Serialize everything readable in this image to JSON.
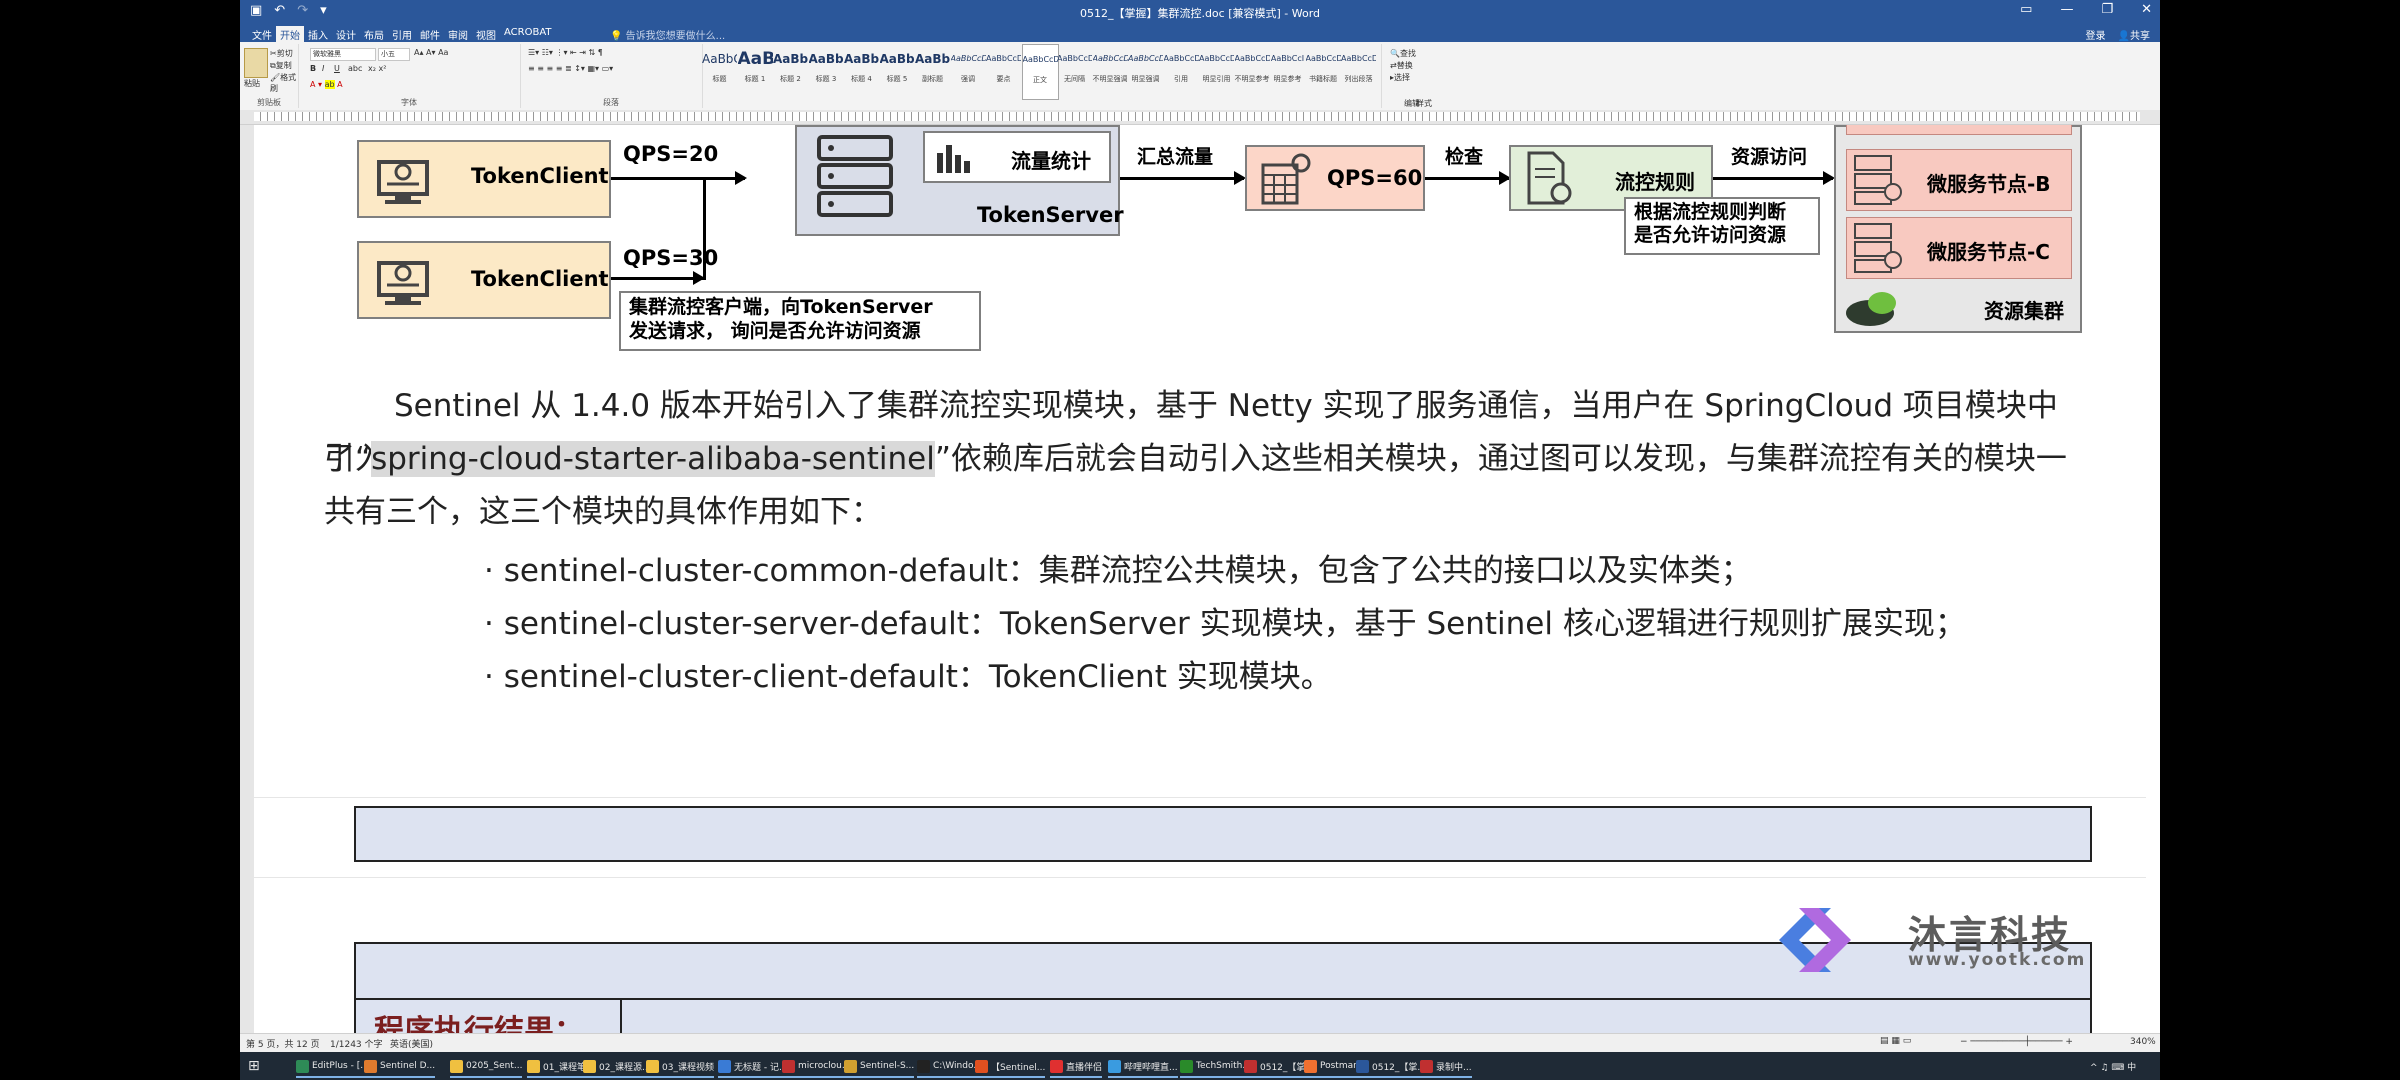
{
  "window": {
    "title": "0512_【掌握】集群流控.doc [兼容模式] - Word"
  },
  "menu": {
    "tabs": [
      "文件",
      "开始",
      "插入",
      "设计",
      "布局",
      "引用",
      "邮件",
      "审阅",
      "视图",
      "ACROBAT"
    ],
    "tell_me": "告诉我您想要做什么...",
    "sign_in": "登录",
    "share": "共享"
  },
  "ribbon": {
    "clipboard": {
      "paste": "粘贴",
      "cut": "剪切",
      "copy": "复制",
      "format_painter": "格式刷",
      "label": "剪贴板"
    },
    "font": {
      "name": "微软雅黑",
      "size": "小五",
      "label": "字体"
    },
    "paragraph": {
      "label": "段落"
    },
    "styles": {
      "label": "样式",
      "items": [
        {
          "preview": "AaBbC",
          "name": "标题"
        },
        {
          "preview": "AaBl",
          "name": "标题 1"
        },
        {
          "preview": "AaBbC",
          "name": "标题 2"
        },
        {
          "preview": "AaBbC",
          "name": "标题 3"
        },
        {
          "preview": "AaBbC",
          "name": "标题 4"
        },
        {
          "preview": "AaBbC",
          "name": "标题 5"
        },
        {
          "preview": "AaBbC",
          "name": "副标题"
        },
        {
          "preview": "AaBbCcDt",
          "name": "强调"
        },
        {
          "preview": "AaBbCcD",
          "name": "要点"
        },
        {
          "preview": "AaBbCcDc",
          "name": "正文"
        },
        {
          "preview": "AaBbCcDc",
          "name": "无间隔"
        },
        {
          "preview": "AaBbCcDc",
          "name": "不明显强调"
        },
        {
          "preview": "AaBbCcDc",
          "name": "明显强调"
        },
        {
          "preview": "AaBbCcDc",
          "name": "引用"
        },
        {
          "preview": "AaBbCcDc",
          "name": "明显引用"
        },
        {
          "preview": "AaBbCcD",
          "name": "不明显参考"
        },
        {
          "preview": "AaBbCcI",
          "name": "明显参考"
        },
        {
          "preview": "AaBbCcD",
          "name": "书籍标题"
        },
        {
          "preview": "AaBbCcDc",
          "name": "列出段落"
        }
      ]
    },
    "editing": {
      "find": "查找",
      "replace": "替换",
      "select": "选择",
      "label": "编辑"
    }
  },
  "diagram": {
    "client1": "TokenClient",
    "client2": "TokenClient",
    "qps1": "QPS=20",
    "qps2": "QPS=30",
    "client_note_1": "集群流控客户端，向TokenServer",
    "client_note_2": "发送请求， 询问是否允许访问资源",
    "flow_stat": "流量统计",
    "token_server": "TokenServer",
    "aggregate": "汇总流量",
    "qps_total": "QPS=60",
    "check": "检查",
    "flow_rule": "流控规则",
    "rule_note_1": "根据流控规则判断",
    "rule_note_2": "是否允许访问资源",
    "resource_access": "资源访问",
    "ms_b": "微服务节点-B",
    "ms_c": "微服务节点-C",
    "resource_cluster": "资源集群"
  },
  "body": {
    "para1_a": "Sentinel 从 1.4.0 版本开始引入了集群流控实现模块，基于 Netty 实现了服务通信，当用户在 SpringCloud 项目模块中引入",
    "para1_b_prefix": "了“",
    "para1_b_highlight": "spring-cloud-starter-alibaba-sentinel",
    "para1_b_suffix": "”依赖库后就会自动引入这些相关模块，通过图可以发现，与集群流控有关的模块一",
    "para1_c": "共有三个，这三个模块的具体作用如下：",
    "bullets": [
      "· sentinel-cluster-common-default：集群流控公共模块，包含了公共的接口以及实体类；",
      "· sentinel-cluster-server-default：TokenServer 实现模块，基于 Sentinel 核心逻辑进行规则扩展实现；",
      "· sentinel-cluster-client-default：TokenClient 实现模块。"
    ],
    "result_label": "程序执行结果："
  },
  "watermark": {
    "name": "沐言科技",
    "url": "www.yootk.com"
  },
  "status": {
    "page": "第 5 页，共 12 页",
    "words": "1/1243 个字",
    "lang": "英语(美国)",
    "zoom": "340%"
  },
  "taskbar": {
    "items": [
      "EditPlus - [...",
      "Sentinel D...",
      "0205_Sent...",
      "01_课程笔记",
      "02_课程源...",
      "03_课程视频",
      "无标题 - 记...",
      "microclou...",
      "Sentinel-S...",
      "C:\\Windo...",
      "【Sentinel...",
      "直播伴侣",
      "哔哩哔哩直...",
      "TechSmith...",
      "0512_【掌...",
      "Postman",
      "0512_【掌...",
      "录制中..."
    ]
  }
}
